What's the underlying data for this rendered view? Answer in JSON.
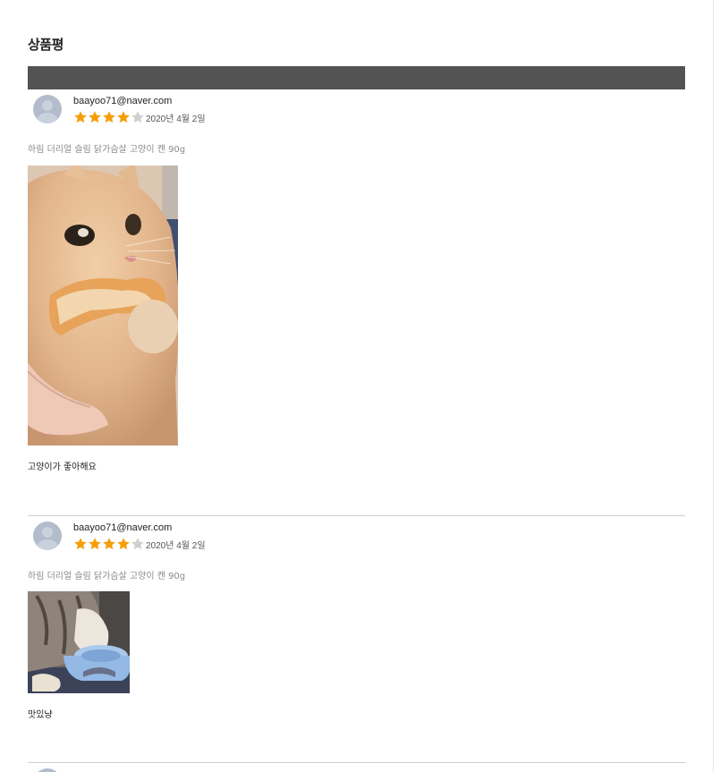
{
  "section": {
    "title": "상품평"
  },
  "reviews": [
    {
      "author": "baayoo71@naver.com",
      "rating": 4,
      "max_rating": 5,
      "date": "2020년 4월 2일",
      "product": "하림 더리얼 슬림 닭가슴살 고양이 캔 90g",
      "comment": "고양이가 좋아해요",
      "photo": "cat-eating-bread-photo"
    },
    {
      "author": "baayoo71@naver.com",
      "rating": 4,
      "max_rating": 5,
      "date": "2020년 4월 2일",
      "product": "하림 더리얼 슬림 닭가슴살 고양이 캔 90g",
      "comment": "맛있냥",
      "photo": "cat-eating-from-bowl-photo"
    }
  ],
  "colors": {
    "header_bar": "#535353",
    "star_on": "#f59e0b",
    "star_off": "#cfcfcf",
    "avatar": "#b2bccb"
  }
}
